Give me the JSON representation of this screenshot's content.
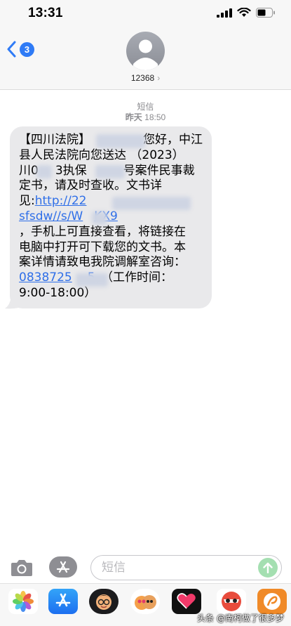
{
  "status_bar": {
    "time": "13:31"
  },
  "nav": {
    "back_badge": "3",
    "contact": "12368"
  },
  "conversation": {
    "type_label": "短信",
    "day": "昨天",
    "time": "18:50"
  },
  "message": {
    "lines": [
      "【四川法院】",
      "您好，中江",
      "县人民法院向您送达 （2023）",
      "川0",
      "3执保",
      "号案件民事裁",
      "定书，请及时查收。文书详",
      "见:",
      "http://22",
      "sfsdw//s/W",
      "KX9",
      "，手机上可直接查看，将链接在",
      "电脑中打开可下载您的文书。本",
      "案详情请致电我院调解室咨询：",
      "0838725",
      "5",
      "。（工作时间：",
      "9:00-18:00）"
    ]
  },
  "input": {
    "placeholder": "短信"
  },
  "watermark": "头条 @南柯做了很多梦",
  "colors": {
    "link": "#2f6fe8",
    "badge": "#2f7bf6",
    "bubble": "#e9e9eb"
  }
}
